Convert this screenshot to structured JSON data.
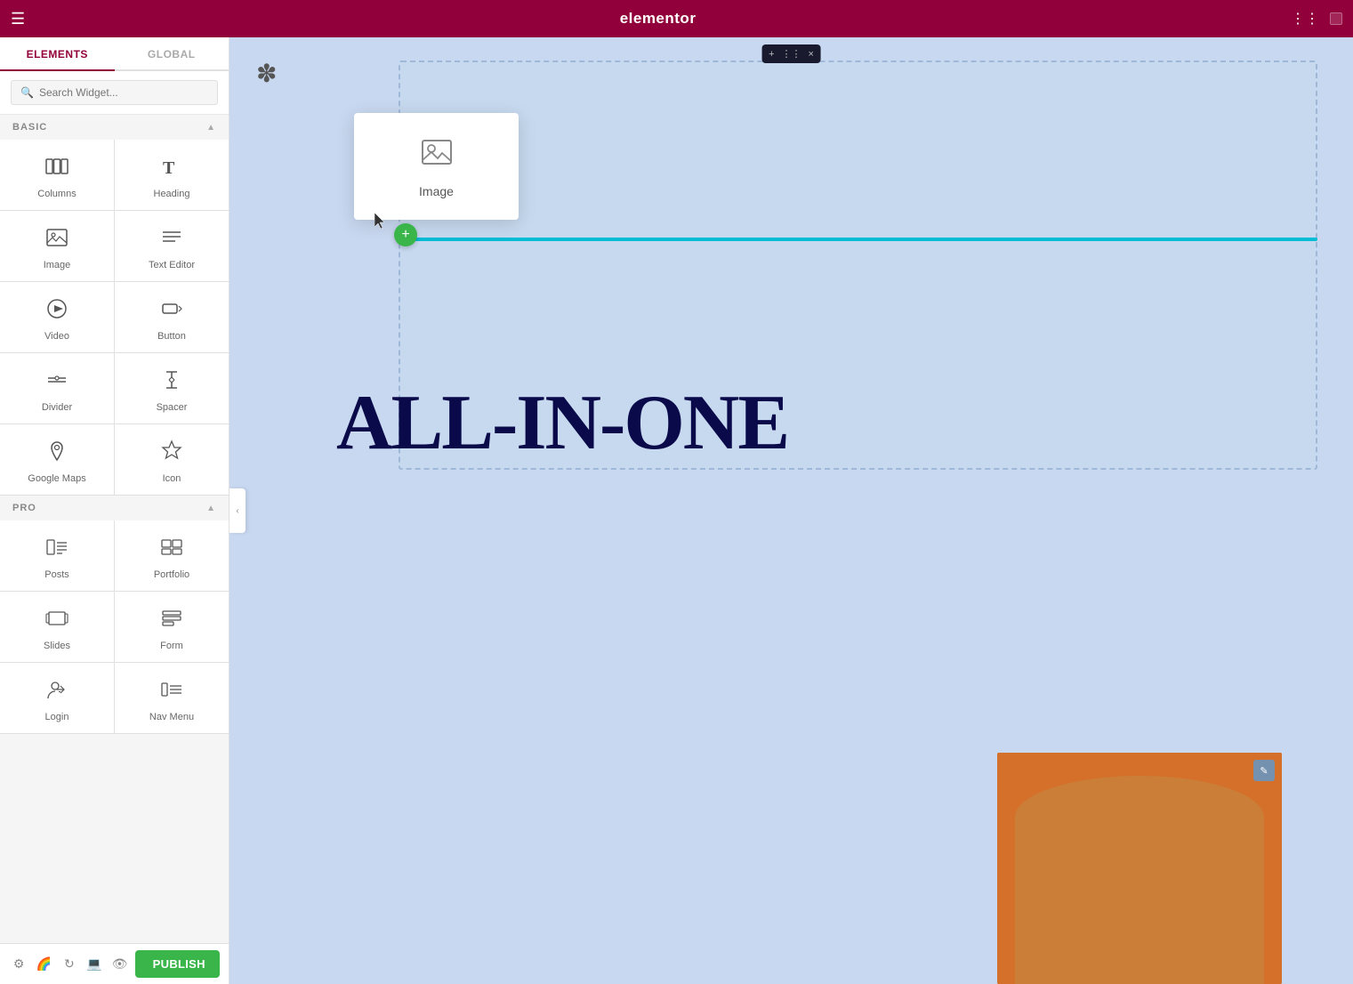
{
  "topbar": {
    "logo": "elementor",
    "hamburger_label": "menu",
    "grid_label": "apps"
  },
  "sidebar": {
    "tabs": [
      {
        "id": "elements",
        "label": "ELEMENTS",
        "active": true
      },
      {
        "id": "global",
        "label": "GLOBAL",
        "active": false
      }
    ],
    "search_placeholder": "Search Widget...",
    "sections": [
      {
        "id": "basic",
        "label": "BASIC",
        "expanded": true,
        "widgets": [
          {
            "id": "columns",
            "label": "Columns",
            "icon": "columns"
          },
          {
            "id": "heading",
            "label": "Heading",
            "icon": "heading"
          },
          {
            "id": "image",
            "label": "Image",
            "icon": "image"
          },
          {
            "id": "text-editor",
            "label": "Text Editor",
            "icon": "text-editor"
          },
          {
            "id": "video",
            "label": "Video",
            "icon": "video"
          },
          {
            "id": "button",
            "label": "Button",
            "icon": "button"
          },
          {
            "id": "divider",
            "label": "Divider",
            "icon": "divider"
          },
          {
            "id": "spacer",
            "label": "Spacer",
            "icon": "spacer"
          },
          {
            "id": "google-maps",
            "label": "Google Maps",
            "icon": "google-maps"
          },
          {
            "id": "icon",
            "label": "Icon",
            "icon": "icon"
          }
        ]
      },
      {
        "id": "pro",
        "label": "PRO",
        "expanded": true,
        "widgets": [
          {
            "id": "posts",
            "label": "Posts",
            "icon": "posts"
          },
          {
            "id": "portfolio",
            "label": "Portfolio",
            "icon": "portfolio"
          },
          {
            "id": "slides",
            "label": "Slides",
            "icon": "slides"
          },
          {
            "id": "form",
            "label": "Form",
            "icon": "form"
          },
          {
            "id": "login",
            "label": "Login",
            "icon": "login"
          },
          {
            "id": "nav-menu",
            "label": "Nav Menu",
            "icon": "nav-menu"
          }
        ]
      }
    ]
  },
  "bottom_bar": {
    "icons": [
      "settings",
      "style",
      "history",
      "responsive",
      "eye"
    ],
    "publish_label": "PUBLISH"
  },
  "canvas": {
    "headline": "ALL-IN-ONE",
    "drag_widget_label": "Image",
    "toolbar_label": "···  ×"
  }
}
